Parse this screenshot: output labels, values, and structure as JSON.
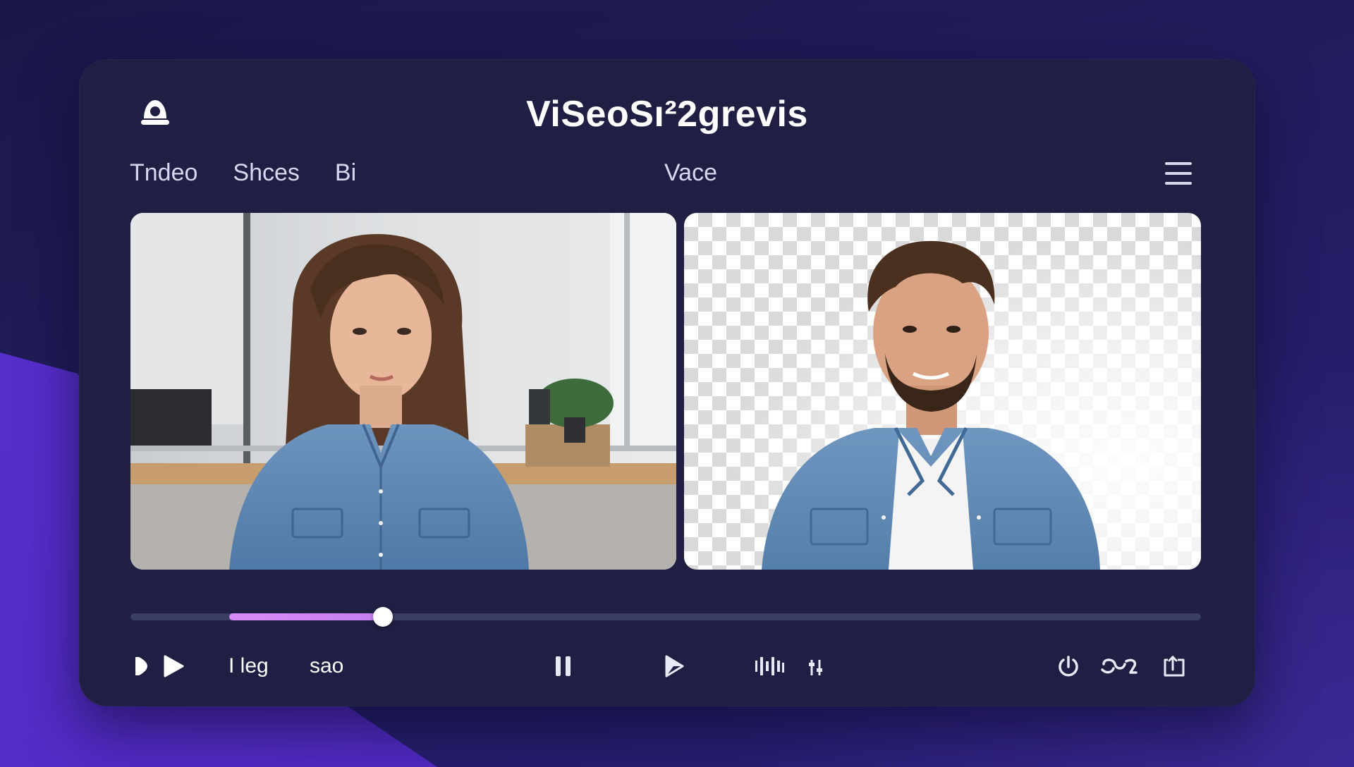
{
  "app": {
    "title": "ViSeoSı²2grevis"
  },
  "nav": {
    "items": [
      {
        "label": "Tndeo"
      },
      {
        "label": "Shces"
      },
      {
        "label": "Bi"
      }
    ],
    "center_label": "Vace"
  },
  "videos": {
    "left": {
      "subject": "woman-in-office"
    },
    "right": {
      "subject": "man-on-transparent-background"
    }
  },
  "timeline": {
    "progress": 0.24
  },
  "controls": {
    "label_1": "I leg",
    "label_2": "sao"
  },
  "colors": {
    "panel": "#1f1f44",
    "accent": "#d88df5",
    "background": "#211d5c",
    "wedge": "#5a2fd0"
  }
}
